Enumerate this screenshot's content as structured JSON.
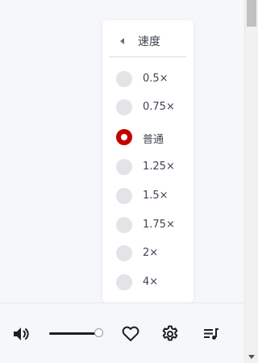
{
  "speed_menu": {
    "title": "速度",
    "options": [
      {
        "label": "0.5×",
        "selected": false
      },
      {
        "label": "0.75×",
        "selected": false
      },
      {
        "label": "普通",
        "selected": true
      },
      {
        "label": "1.25×",
        "selected": false
      },
      {
        "label": "1.5×",
        "selected": false
      },
      {
        "label": "1.75×",
        "selected": false
      },
      {
        "label": "2×",
        "selected": false
      },
      {
        "label": "4×",
        "selected": false
      }
    ]
  },
  "player": {
    "volume_level": 0.9,
    "icons": {
      "volume": "volume-icon",
      "like": "heart-icon",
      "settings": "gear-icon",
      "queue": "queue-icon"
    }
  },
  "colors": {
    "selected_radio": "#c40000",
    "unselected_radio": "#e3e4e8",
    "text": "#3e4452",
    "background": "#f6f7fa"
  }
}
